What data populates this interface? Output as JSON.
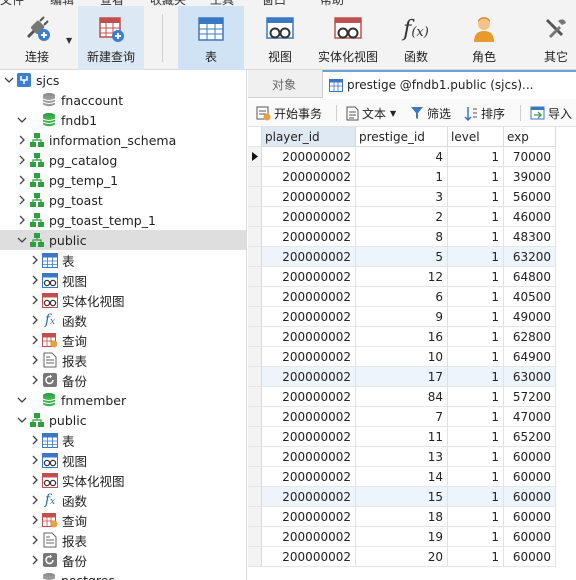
{
  "menubar": {
    "items": [
      "文件",
      "编辑",
      "查看",
      "收藏夹",
      "工具",
      "窗口",
      "帮助"
    ]
  },
  "toolbar": {
    "buttons": [
      {
        "label": "连接",
        "icon": "plug-icon"
      },
      {
        "label": "新建查询",
        "icon": "new-query-icon"
      },
      {
        "label": "表",
        "icon": "table-icon"
      },
      {
        "label": "视图",
        "icon": "view-icon"
      },
      {
        "label": "实体化视图",
        "icon": "materialized-view-icon"
      },
      {
        "label": "函数",
        "icon": "function-icon"
      },
      {
        "label": "角色",
        "icon": "role-icon"
      },
      {
        "label": "其它",
        "icon": "other-icon"
      }
    ]
  },
  "tree": {
    "nodes": [
      {
        "label": "sjcs",
        "level": 0,
        "expanded": true,
        "icon": "connection-icon"
      },
      {
        "label": "fnaccount",
        "level": 1,
        "expanded": null,
        "icon": "database-icon"
      },
      {
        "label": "fndb1",
        "level": 1,
        "expanded": true,
        "icon": "database-open-icon"
      },
      {
        "label": "information_schema",
        "level": 2,
        "expanded": false,
        "icon": "schema-icon"
      },
      {
        "label": "pg_catalog",
        "level": 2,
        "expanded": false,
        "icon": "schema-icon"
      },
      {
        "label": "pg_temp_1",
        "level": 2,
        "expanded": false,
        "icon": "schema-icon"
      },
      {
        "label": "pg_toast",
        "level": 2,
        "expanded": false,
        "icon": "schema-icon"
      },
      {
        "label": "pg_toast_temp_1",
        "level": 2,
        "expanded": false,
        "icon": "schema-icon"
      },
      {
        "label": "public",
        "level": 2,
        "expanded": true,
        "icon": "schema-icon",
        "selected": true
      },
      {
        "label": "表",
        "level": 3,
        "expanded": false,
        "icon": "table-icon"
      },
      {
        "label": "视图",
        "level": 3,
        "expanded": false,
        "icon": "view-icon"
      },
      {
        "label": "实体化视图",
        "level": 3,
        "expanded": false,
        "icon": "materialized-view-icon"
      },
      {
        "label": "函数",
        "level": 3,
        "expanded": false,
        "icon": "function-icon"
      },
      {
        "label": "查询",
        "level": 3,
        "expanded": false,
        "icon": "query-icon"
      },
      {
        "label": "报表",
        "level": 3,
        "expanded": false,
        "icon": "report-icon"
      },
      {
        "label": "备份",
        "level": 3,
        "expanded": false,
        "icon": "backup-icon"
      },
      {
        "label": "fnmember",
        "level": 1,
        "expanded": true,
        "icon": "database-open-icon"
      },
      {
        "label": "public",
        "level": 2,
        "expanded": true,
        "icon": "schema-icon"
      },
      {
        "label": "表",
        "level": 3,
        "expanded": false,
        "icon": "table-icon"
      },
      {
        "label": "视图",
        "level": 3,
        "expanded": false,
        "icon": "view-icon"
      },
      {
        "label": "实体化视图",
        "level": 3,
        "expanded": false,
        "icon": "materialized-view-icon"
      },
      {
        "label": "函数",
        "level": 3,
        "expanded": false,
        "icon": "function-icon"
      },
      {
        "label": "查询",
        "level": 3,
        "expanded": false,
        "icon": "query-icon"
      },
      {
        "label": "报表",
        "level": 3,
        "expanded": false,
        "icon": "report-icon"
      },
      {
        "label": "备份",
        "level": 3,
        "expanded": false,
        "icon": "backup-icon"
      },
      {
        "label": "postgres",
        "level": 1,
        "expanded": null,
        "icon": "database-icon"
      }
    ]
  },
  "tabs": {
    "objects_label": "对象",
    "active_label": "prestige @fndb1.public (sjcs)..."
  },
  "subtoolbar": {
    "begin_transaction": "开始事务",
    "text": "文本",
    "filter": "筛选",
    "sort": "排序",
    "import": "导入"
  },
  "table": {
    "columns": [
      "player_id",
      "prestige_id",
      "level",
      "exp"
    ],
    "rows": [
      [
        "200000002",
        "4",
        "1",
        "70000"
      ],
      [
        "200000002",
        "1",
        "1",
        "39000"
      ],
      [
        "200000002",
        "3",
        "1",
        "56000"
      ],
      [
        "200000002",
        "2",
        "1",
        "46000"
      ],
      [
        "200000002",
        "8",
        "1",
        "48300"
      ],
      [
        "200000002",
        "5",
        "1",
        "63200"
      ],
      [
        "200000002",
        "12",
        "1",
        "64800"
      ],
      [
        "200000002",
        "6",
        "1",
        "40500"
      ],
      [
        "200000002",
        "9",
        "1",
        "49000"
      ],
      [
        "200000002",
        "16",
        "1",
        "62800"
      ],
      [
        "200000002",
        "10",
        "1",
        "64900"
      ],
      [
        "200000002",
        "17",
        "1",
        "63000"
      ],
      [
        "200000002",
        "84",
        "1",
        "57200"
      ],
      [
        "200000002",
        "7",
        "1",
        "47000"
      ],
      [
        "200000002",
        "11",
        "1",
        "65200"
      ],
      [
        "200000002",
        "13",
        "1",
        "60000"
      ],
      [
        "200000002",
        "14",
        "1",
        "60000"
      ],
      [
        "200000002",
        "15",
        "1",
        "60000"
      ],
      [
        "200000002",
        "18",
        "1",
        "60000"
      ],
      [
        "200000002",
        "19",
        "1",
        "60000"
      ],
      [
        "200000002",
        "20",
        "1",
        "60000"
      ]
    ],
    "current_row": 0,
    "highlight_rows": [
      5,
      11,
      17
    ]
  },
  "colors": {
    "accent": "#cfe3f5",
    "selected_tree": "#dedede",
    "db_green": "#2e9e3e",
    "table_blue": "#3b78c4"
  }
}
